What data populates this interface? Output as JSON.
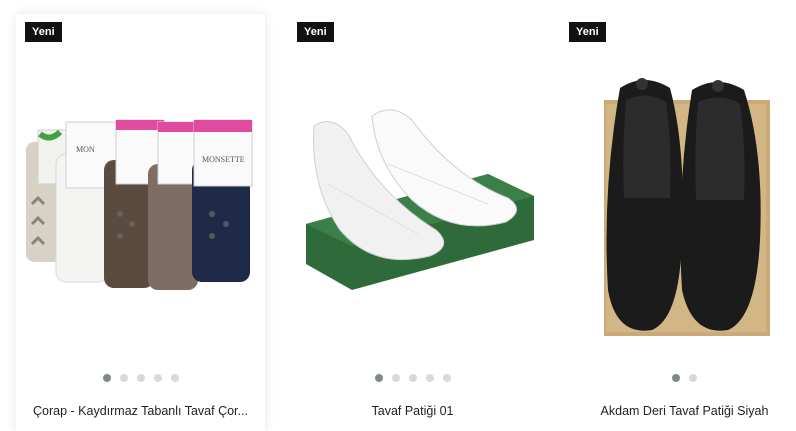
{
  "products": [
    {
      "badge": "Yeni",
      "title": "Çorap - Kaydırmaz Tabanlı Tavaf Çor...",
      "image_desc_icon": "socks-product-image",
      "gallery": {
        "count": 5,
        "active": 1
      },
      "hovered": true
    },
    {
      "badge": "Yeni",
      "title": "Tavaf Patiği 01",
      "image_desc_icon": "white-slippers-product-image",
      "gallery": {
        "count": 5,
        "active": 1
      },
      "hovered": false
    },
    {
      "badge": "Yeni",
      "title": "Akdam Deri Tavaf Patiği Siyah",
      "image_desc_icon": "black-leather-slippers-product-image",
      "gallery": {
        "count": 2,
        "active": 1
      },
      "hovered": false
    }
  ],
  "colors": {
    "badge_bg": "#111111",
    "dot_active": "#7d8a8a",
    "dot_inactive": "#d9d9d9"
  }
}
